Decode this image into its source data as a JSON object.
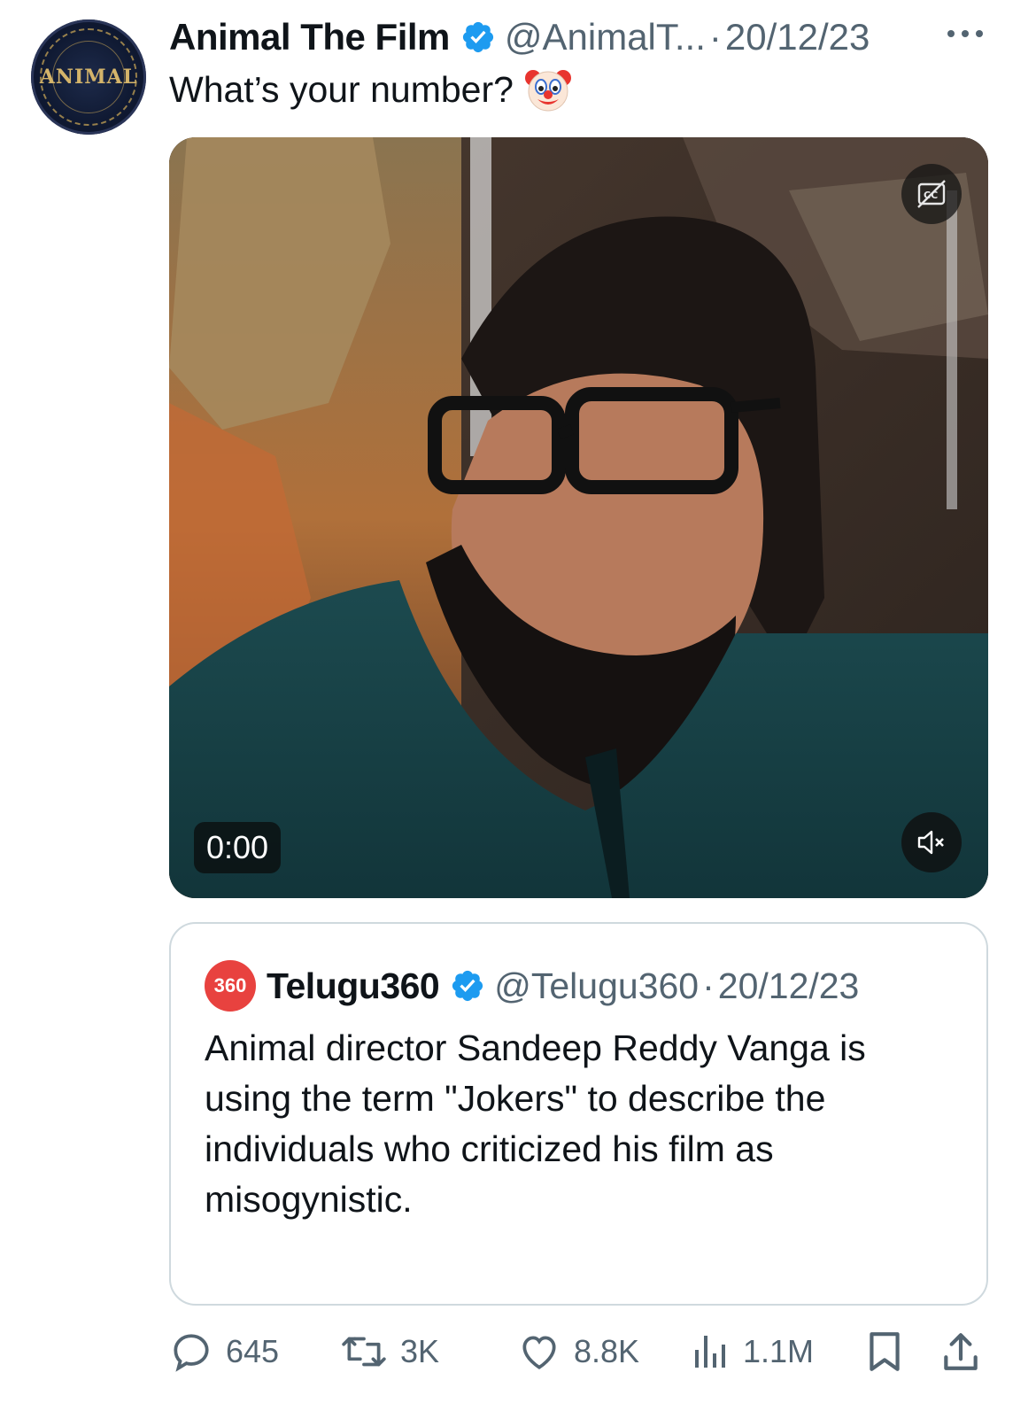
{
  "tweet": {
    "author_name": "Animal The Film",
    "avatar_text": "ANIMAL",
    "handle": "@AnimalT...",
    "date": "20/12/23",
    "separator": "·",
    "text": "What’s your number?",
    "emoji": "clown-face-icon"
  },
  "media": {
    "timestamp": "0:00",
    "cc_icon": "captions-off-icon",
    "mute_icon": "volume-muted-icon"
  },
  "quote": {
    "avatar_text": "360",
    "author_name": "Telugu360",
    "handle": "@Telugu360",
    "separator": "·",
    "date": "20/12/23",
    "text": "Animal director Sandeep Reddy Vanga is using the term \"Jokers\" to describe the individuals who criticized his film as misogynistic."
  },
  "actions": {
    "replies": "645",
    "reposts": "3K",
    "likes": "8.8K",
    "views": "1.1M"
  },
  "colors": {
    "verified": "#1d9bf0",
    "secondary_text": "#536471",
    "border": "#cfd9de"
  }
}
